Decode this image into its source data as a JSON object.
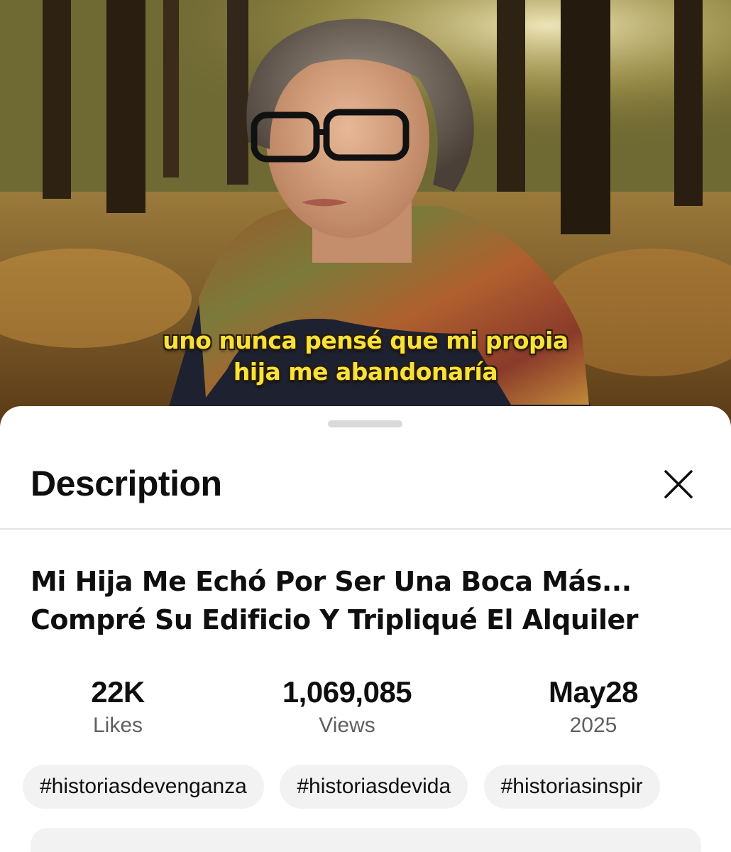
{
  "video": {
    "caption_line1": "uno nunca pensé que mi propia",
    "caption_line2": "hija me abandonaría"
  },
  "sheet": {
    "title": "Description",
    "close_icon": "close-icon"
  },
  "description": {
    "title_line1": "Mi Hija Me Echó Por Ser Una Boca Más...",
    "title_line2": "Compré Su Edificio Y Tripliqué El Alquiler",
    "stats": {
      "likes_value": "22K",
      "likes_label": "Likes",
      "views_value": "1,069,085",
      "views_label": "Views",
      "date_value": "May28",
      "date_label": "2025"
    },
    "tags": [
      "#historiasdevenganza",
      "#historiasdevida",
      "#historiasinspir"
    ]
  },
  "colors": {
    "caption": "#f7e23a",
    "sheet_bg": "#ffffff",
    "chip_bg": "#f2f2f2",
    "secondary_text": "#606060"
  }
}
